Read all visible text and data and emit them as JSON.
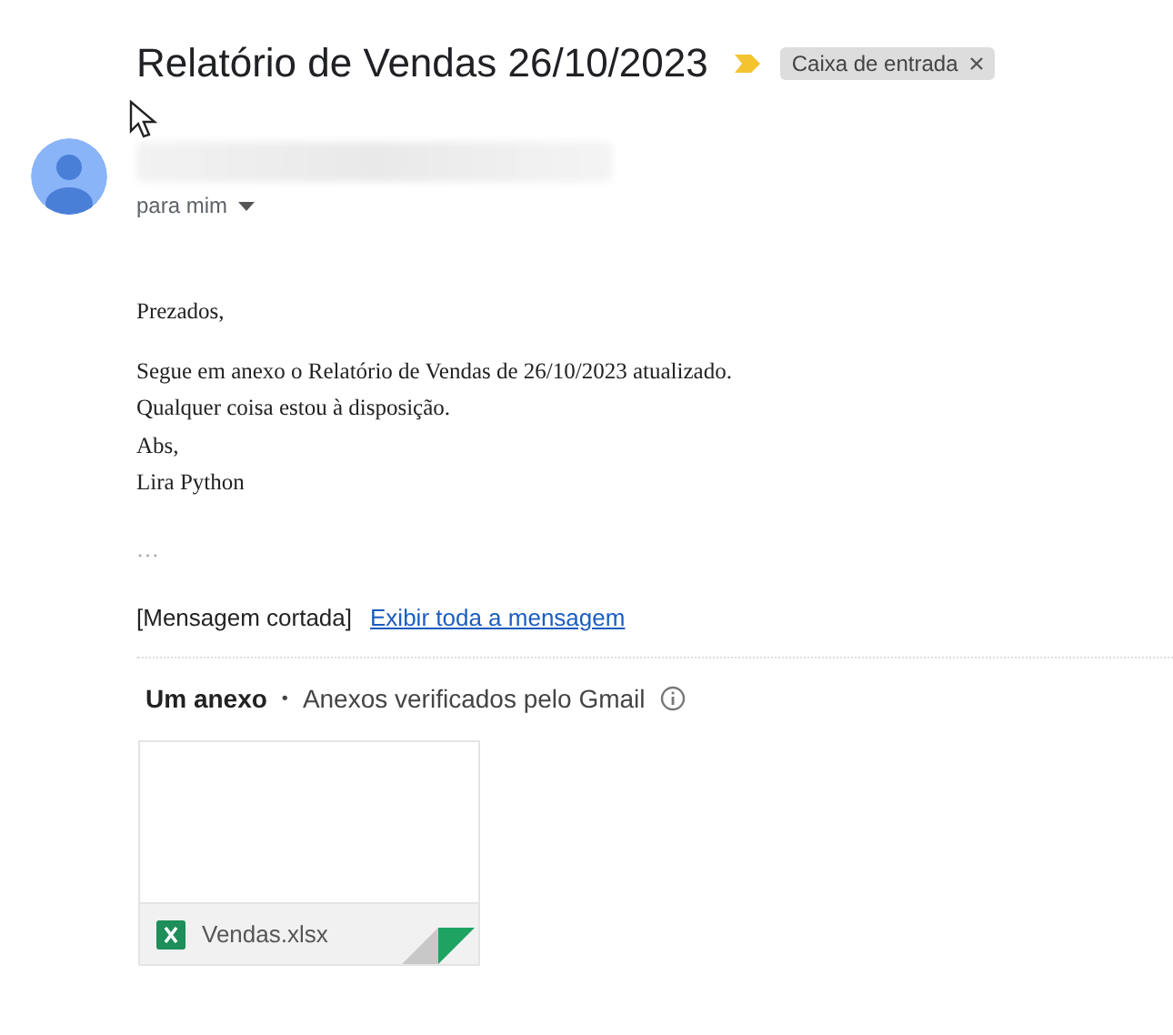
{
  "subject": "Relatório de Vendas 26/10/2023",
  "labels": [
    {
      "text": "Caixa de entrada",
      "removable": true
    }
  ],
  "recipient": {
    "text": "para mim",
    "expanded": false
  },
  "body": [
    [
      "Prezados,"
    ],
    [
      "Segue em anexo o Relatório de Vendas de 26/10/2023 atualizado.",
      "Qualquer coisa estou à disposição.",
      "Abs,",
      "Lira Python"
    ]
  ],
  "trimmed_marker": "…",
  "clipped": {
    "note": "[Mensagem cortada]",
    "link": "Exibir toda a mensagem"
  },
  "attachments_header": {
    "count": "Um anexo",
    "separator": "•",
    "scan_note": "Anexos verificados pelo Gmail"
  },
  "attachments": [
    {
      "name": "Vendas.xlsx",
      "kind": "spreadsheet"
    }
  ]
}
